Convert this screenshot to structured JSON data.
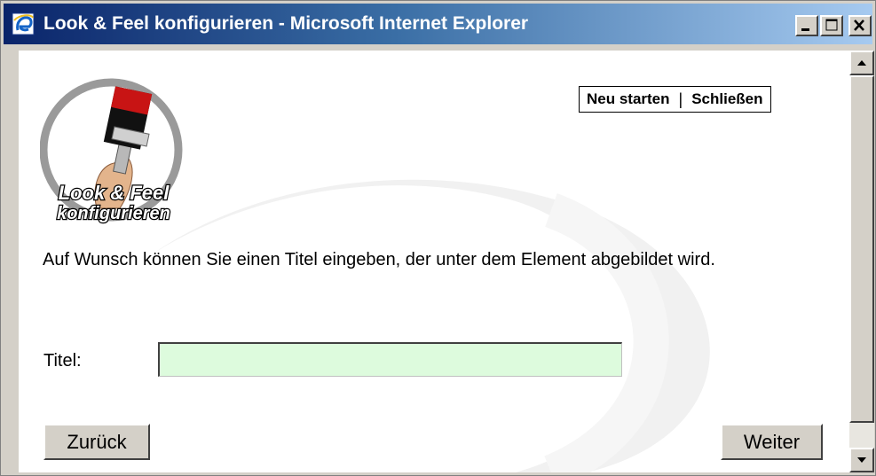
{
  "window": {
    "title": "Look & Feel konfigurieren - Microsoft Internet Explorer",
    "controls": [
      "minimize",
      "maximize",
      "close"
    ]
  },
  "logo": {
    "line1": "Look & Feel",
    "line2": "konfigurieren",
    "icon": "paintbrush-icon"
  },
  "top_links": {
    "restart": "Neu starten",
    "separator": "|",
    "close": "Schließen"
  },
  "content": {
    "instruction": "Auf Wunsch können Sie einen Titel eingeben, der unter dem Element abgebildet wird.",
    "field_label": "Titel:",
    "field_value": "",
    "field_placeholder": ""
  },
  "buttons": {
    "back": "Zurück",
    "next": "Weiter"
  },
  "colors": {
    "titlebar_start": "#0a246a",
    "titlebar_end": "#a6caf0",
    "input_bg": "#ddfbdd",
    "chrome": "#d4d0c8"
  }
}
